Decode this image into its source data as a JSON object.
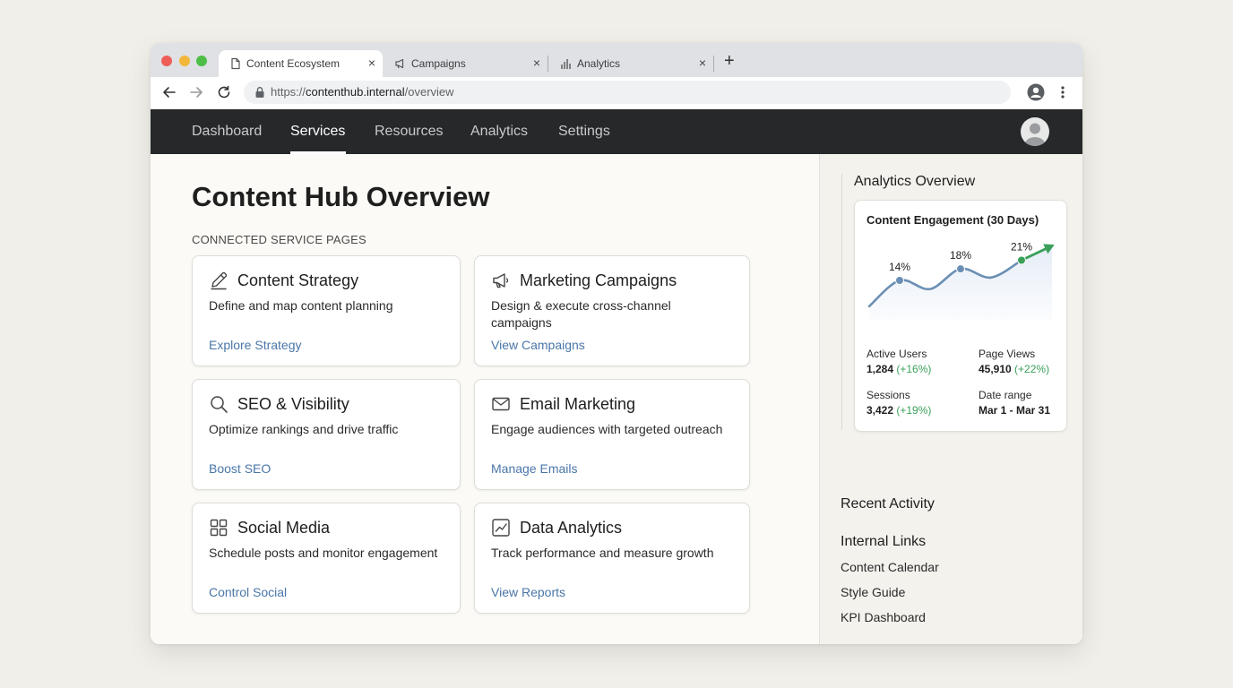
{
  "browser": {
    "tabs": [
      {
        "label": "Content Ecosystem",
        "icon": "document-icon",
        "active": true
      },
      {
        "label": "Campaigns",
        "icon": "megaphone-icon",
        "active": false
      },
      {
        "label": "Analytics",
        "icon": "bar-chart-icon",
        "active": false
      }
    ],
    "close_glyph": "×",
    "newtab_glyph": "+",
    "url": {
      "prefix": "https://",
      "host": "contenthub.internal",
      "path": "/overview"
    }
  },
  "appnav": {
    "items": [
      "Dashboard",
      "Services",
      "Resources",
      "Analytics",
      "Settings"
    ],
    "active": "Services"
  },
  "main": {
    "title": "Content Hub Overview",
    "section_label": "CONNECTED SERVICE PAGES",
    "cards": [
      {
        "icon": "pencil-icon",
        "title": "Content Strategy",
        "desc": "Define and map content planning",
        "link": "Explore Strategy"
      },
      {
        "icon": "megaphone-icon",
        "title": "Marketing Campaigns",
        "desc": "Design & execute cross-channel campaigns",
        "link": "View Campaigns"
      },
      {
        "icon": "search-icon",
        "title": "SEO & Visibility",
        "desc": "Optimize rankings and drive traffic",
        "link": "Boost SEO"
      },
      {
        "icon": "mail-icon",
        "title": "Email Marketing",
        "desc": "Engage audiences with targeted outreach",
        "link": "Manage Emails"
      },
      {
        "icon": "grid-icon",
        "title": "Social Media",
        "desc": "Schedule posts and monitor engagement",
        "link": "Control Social"
      },
      {
        "icon": "line-chart-icon",
        "title": "Data Analytics",
        "desc": "Track performance and measure growth",
        "link": "View Reports"
      }
    ]
  },
  "sidebar": {
    "title": "Analytics Overview",
    "stats": [
      {
        "label": "Active Users",
        "value": "1,284",
        "change": "(+16%)"
      },
      {
        "label": "Page Views",
        "value": "45,910",
        "change": "(+22%)"
      },
      {
        "label": "Sessions",
        "value": "3,422",
        "change": "(+19%)"
      },
      {
        "label": "Date range",
        "value": "Mar 1 - Mar 31",
        "change": ""
      }
    ],
    "recent_activity_title": "Recent Activity",
    "internal_links_title": "Internal Links",
    "internal_links": [
      "Content Calendar",
      "Style Guide",
      "KPI Dashboard"
    ]
  },
  "chart_data": {
    "type": "line",
    "title": "Content Engagement (30 Days)",
    "series": [
      {
        "values": [
          5,
          14,
          11,
          18,
          15,
          21,
          26
        ]
      }
    ],
    "point_labels": [
      {
        "index": 1,
        "label": "14%"
      },
      {
        "index": 3,
        "label": "18%"
      },
      {
        "index": 5,
        "label": "21%"
      }
    ],
    "ylim": [
      0,
      28
    ],
    "grid": false,
    "line_color": "#6b8fb4",
    "end_color": "#3aa05a",
    "area_color": "#e6edf7"
  }
}
